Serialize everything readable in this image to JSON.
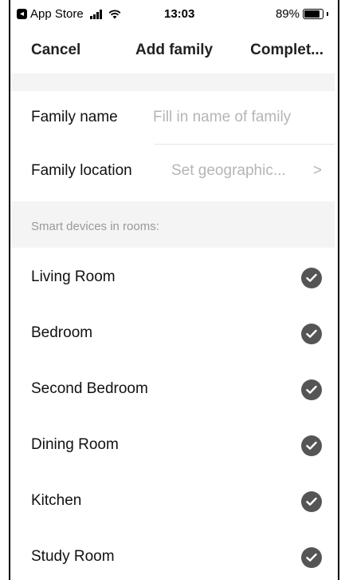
{
  "status_bar": {
    "back_app": "App Store",
    "time": "13:03",
    "battery": "89%"
  },
  "nav": {
    "cancel": "Cancel",
    "title": "Add family",
    "complete": "Complet..."
  },
  "form": {
    "name_label": "Family name",
    "name_placeholder": "Fill in name of family",
    "location_label": "Family location",
    "location_value": "Set geographic...",
    "location_chevron": ">"
  },
  "section_header": "Smart devices in rooms:",
  "rooms": [
    {
      "name": "Living Room",
      "checked": true
    },
    {
      "name": "Bedroom",
      "checked": true
    },
    {
      "name": "Second Bedroom",
      "checked": true
    },
    {
      "name": "Dining Room",
      "checked": true
    },
    {
      "name": "Kitchen",
      "checked": true
    },
    {
      "name": "Study Room",
      "checked": true
    }
  ],
  "colors": {
    "check_fill": "#555555",
    "section_bg": "#f4f4f4",
    "placeholder": "#b5b5b5"
  },
  "icons": [
    "back-app-icon",
    "cellular-signal-icon",
    "wifi-icon",
    "battery-icon",
    "chevron-right-icon",
    "checkmark-circle-icon"
  ]
}
